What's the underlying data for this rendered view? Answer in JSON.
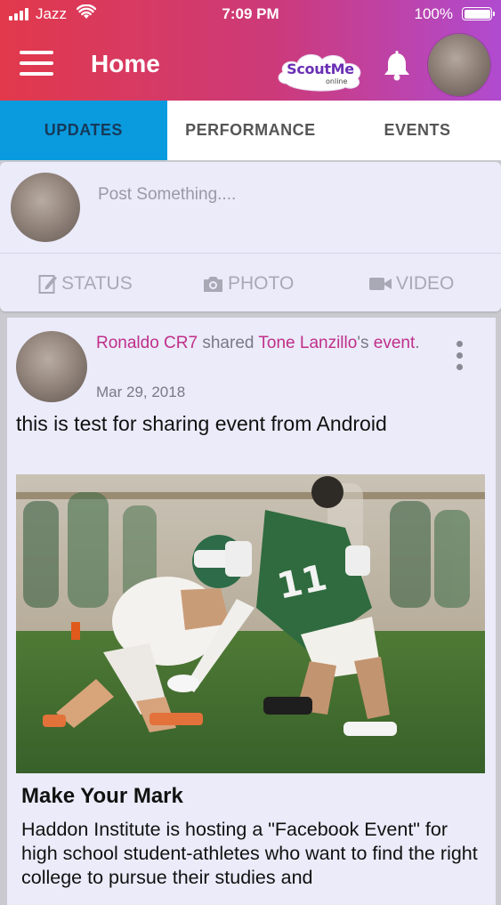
{
  "status_bar": {
    "carrier": "Jazz",
    "time": "7:09 PM",
    "battery": "100%"
  },
  "header": {
    "title": "Home",
    "logo_text": "ScoutMe",
    "logo_sub": "online"
  },
  "tabs": [
    {
      "label": "UPDATES",
      "active": true
    },
    {
      "label": "PERFORMANCE",
      "active": false
    },
    {
      "label": "EVENTS",
      "active": false
    }
  ],
  "composer": {
    "placeholder": "Post Something....",
    "actions": [
      {
        "label": "STATUS",
        "icon": "edit-icon"
      },
      {
        "label": "PHOTO",
        "icon": "camera-icon"
      },
      {
        "label": "VIDEO",
        "icon": "video-camera-icon"
      }
    ]
  },
  "post": {
    "author": "Ronaldo CR7",
    "verb": "shared",
    "target_user": "Tone Lanzillo",
    "possessive": "'s",
    "target_object": "event",
    "period": ".",
    "date": "Mar 29, 2018",
    "text": "this is test for sharing event from Android",
    "event_title": "Make Your Mark",
    "event_description": "Haddon Institute is hosting a \"Facebook Event\" for high school student-athletes who want to find the right college to pursue their studies and"
  },
  "colors": {
    "header_gradient_start": "#e2394b",
    "header_gradient_end": "#b04bd0",
    "tab_active": "#0a9bde",
    "link_pink": "#c02f8a",
    "card_bg": "#ebebfa"
  }
}
